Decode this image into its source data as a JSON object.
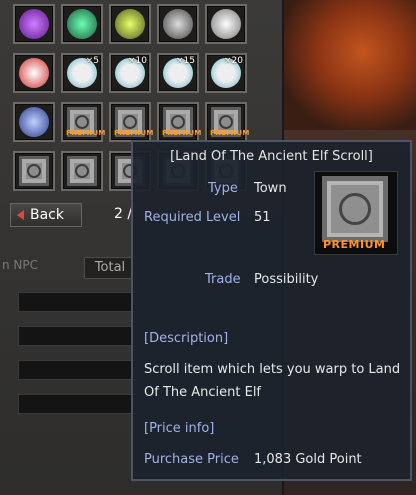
{
  "inventory": {
    "slots": [
      {
        "icon": "purple-orb-icon",
        "count": ""
      },
      {
        "icon": "green-gear-icon",
        "count": ""
      },
      {
        "icon": "yellow-gear-icon",
        "count": ""
      },
      {
        "icon": "skull-gear-icon",
        "count": ""
      },
      {
        "icon": "helmet-icon",
        "count": ""
      },
      {
        "icon": "red-helmet-icon",
        "count": ""
      },
      {
        "icon": "cat-mask-icon",
        "count": "×5"
      },
      {
        "icon": "cat-mask-icon",
        "count": "×10"
      },
      {
        "icon": "cat-mask-icon",
        "count": "×15"
      },
      {
        "icon": "cat-mask-icon",
        "count": "×20"
      },
      {
        "icon": "swirl-gem-icon",
        "count": ""
      },
      {
        "icon": "premium-scroll-icon",
        "count": "",
        "premium": "PREMIUM"
      },
      {
        "icon": "premium-scroll-icon",
        "count": "",
        "premium": "PREMIUM"
      },
      {
        "icon": "premium-scroll-icon",
        "count": "",
        "premium": "PREMIUM"
      },
      {
        "icon": "premium-scroll-icon",
        "count": "",
        "premium": "PREMIUM"
      },
      {
        "icon": "scroll-icon",
        "count": ""
      },
      {
        "icon": "scroll-icon",
        "count": ""
      },
      {
        "icon": "scroll-icon",
        "count": ""
      },
      {
        "icon": "scroll-icon",
        "count": ""
      },
      {
        "icon": "scroll-icon",
        "count": ""
      }
    ],
    "back_label": "Back",
    "page": "2 /",
    "npc_label": "n NPC",
    "total_label": "Total"
  },
  "tooltip": {
    "title": "[Land Of The Ancient Elf Scroll]",
    "type_label": "Type",
    "type_value": "Town",
    "level_label": "Required Level",
    "level_value": "51",
    "trade_label": "Trade",
    "trade_value": "Possibility",
    "desc_header": "[Description]",
    "desc_text": "Scroll item which lets you warp to Land Of The Ancient Elf",
    "price_header": "[Price info]",
    "price_label": "Purchase Price",
    "price_value": "1,083 Gold Point",
    "image_premium": "PREMIUM"
  },
  "colors": {
    "label_blue": "#9fb3e8",
    "premium_orange": "#ff9226",
    "tooltip_bg": "#1c222c"
  }
}
